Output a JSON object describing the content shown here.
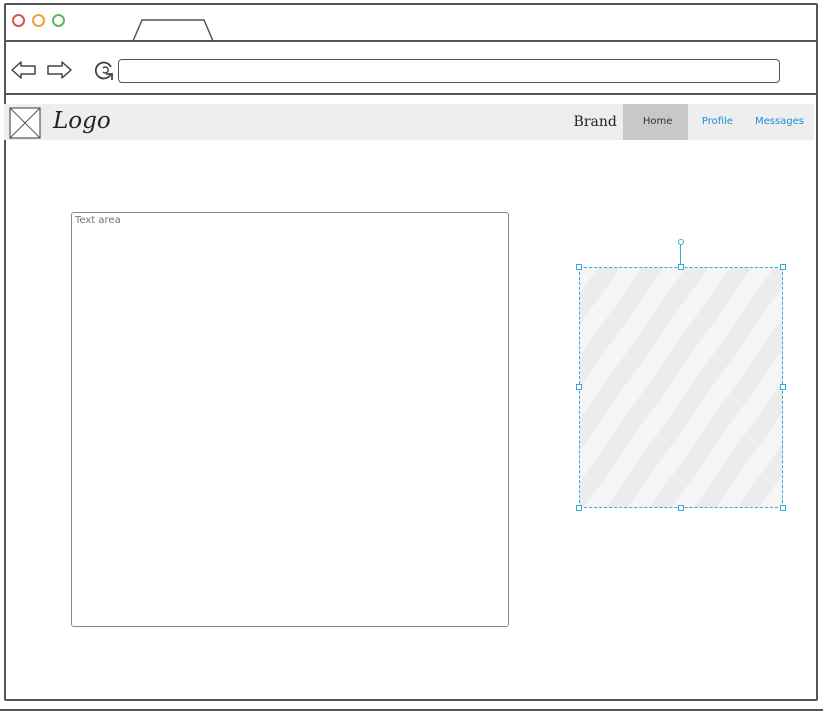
{
  "window": {
    "traffic_lights": [
      "close",
      "minimize",
      "maximize"
    ],
    "colors": {
      "close": "#d9534f",
      "minimize": "#e8a33a",
      "maximize": "#5cb85c"
    }
  },
  "toolbar": {
    "back_icon": "arrow-left-icon",
    "forward_icon": "arrow-right-icon",
    "reload_icon": "reload-icon",
    "url_value": ""
  },
  "header": {
    "logo_text": "Logo",
    "brand": "Brand",
    "nav": [
      {
        "label": "Home",
        "active": true
      },
      {
        "label": "Profile",
        "active": false
      },
      {
        "label": "Messages",
        "active": false
      }
    ],
    "colors": {
      "link": "#1a8fd1",
      "active_bg": "#c8c8c8",
      "header_bg": "#eeeeee"
    }
  },
  "main": {
    "textarea_placeholder": "Text area",
    "image_selected": true,
    "selection_color": "#3aa8d8"
  }
}
